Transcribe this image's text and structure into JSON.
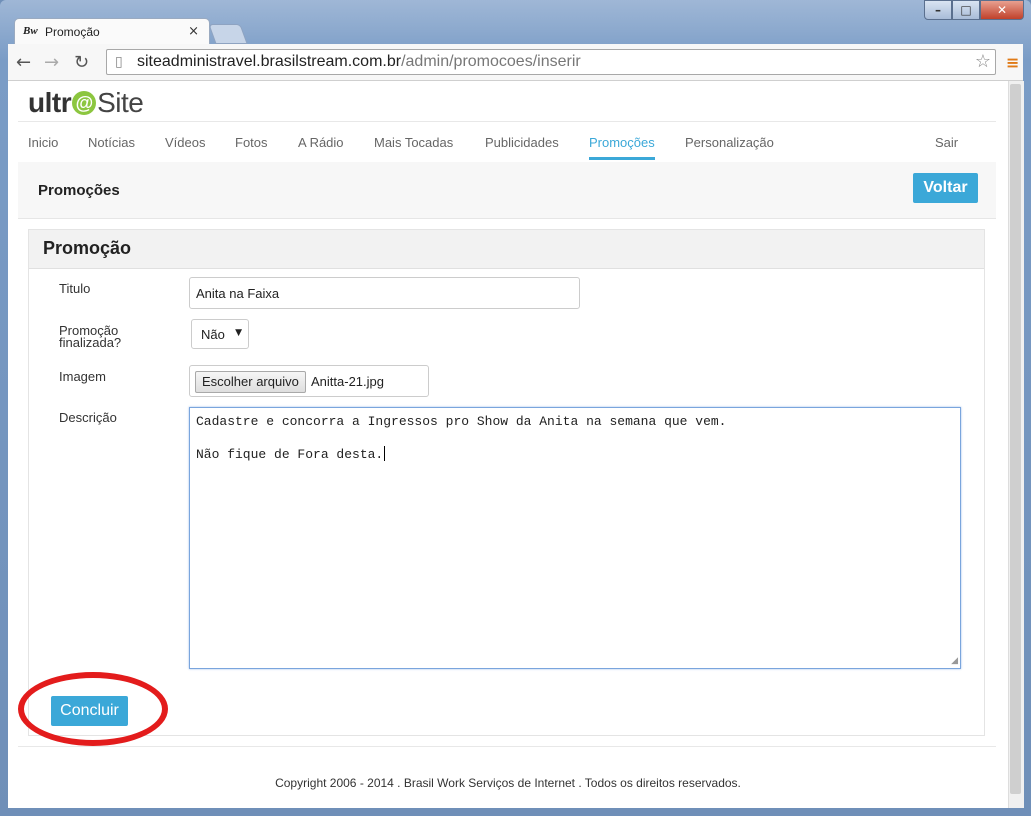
{
  "browser": {
    "tab_title": "Promoção",
    "tab_icon_label": "Bw",
    "url_host": "siteadministravel.brasilstream.com.br",
    "url_path": "/admin/promocoes/inserir"
  },
  "logo": {
    "part1": "ultr",
    "at": "@",
    "part2": "Site"
  },
  "nav": {
    "items": [
      "Inicio",
      "Notícias",
      "Vídeos",
      "Fotos",
      "A Rádio",
      "Mais Tocadas",
      "Publicidades",
      "Promoções",
      "Personalização"
    ],
    "active": "Promoções",
    "logout": "Sair"
  },
  "header": {
    "title": "Promoções",
    "back_button": "Voltar"
  },
  "panel": {
    "title": "Promoção"
  },
  "form": {
    "titulo_label": "Titulo",
    "titulo_value": "Anita na Faixa",
    "finalizada_label": "Promoção finalizada?",
    "finalizada_value": "Não",
    "imagem_label": "Imagem",
    "file_button": "Escolher arquivo",
    "file_name": "Anitta-21.jpg",
    "descricao_label": "Descrição",
    "descricao_line1": "Cadastre e concorra a Ingressos pro Show da Anita na semana que vem.",
    "descricao_line2": "Não fique de Fora desta.",
    "submit": "Concluir"
  },
  "footer": "Copyright 2006 - 2014 . Brasil Work Serviços de Internet . Todos os direitos reservados.",
  "colors": {
    "accent": "#3ba8d8",
    "annotation": "#e31c1c",
    "logo_green": "#8cc63f"
  }
}
